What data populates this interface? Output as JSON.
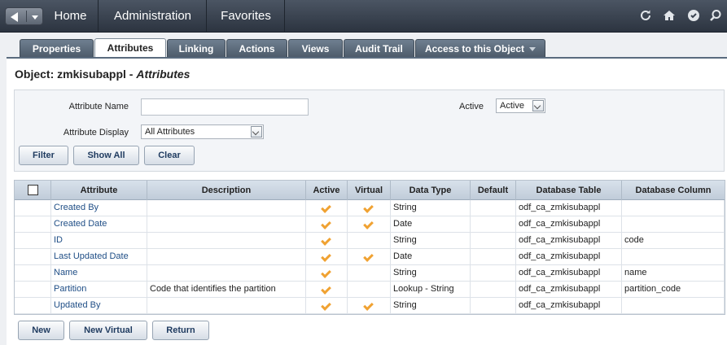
{
  "nav": {
    "home": "Home",
    "administration": "Administration",
    "favorites": "Favorites",
    "icons": [
      "refresh-icon",
      "home-icon",
      "help-icon",
      "search-icon"
    ]
  },
  "tabs": [
    {
      "label": "Properties",
      "active": false
    },
    {
      "label": "Attributes",
      "active": true
    },
    {
      "label": "Linking",
      "active": false
    },
    {
      "label": "Actions",
      "active": false
    },
    {
      "label": "Views",
      "active": false
    },
    {
      "label": "Audit Trail",
      "active": false
    },
    {
      "label": "Access to this Object",
      "active": false
    }
  ],
  "page": {
    "title_prefix": "Object: zmkisubappl - ",
    "title_italic": "Attributes"
  },
  "filter": {
    "attribute_name_label": "Attribute Name",
    "attribute_name_value": "",
    "attribute_display_label": "Attribute Display",
    "attribute_display_value": "All Attributes",
    "active_label": "Active",
    "active_value": "Active",
    "filter_btn": "Filter",
    "show_all_btn": "Show All",
    "clear_btn": "Clear"
  },
  "grid": {
    "columns": [
      "Attribute",
      "Description",
      "Active",
      "Virtual",
      "Data Type",
      "Default",
      "Database Table",
      "Database Column"
    ],
    "rows": [
      {
        "attribute": "Created By",
        "description": "",
        "active": true,
        "virtual": true,
        "data_type": "String",
        "default": "",
        "db_table": "odf_ca_zmkisubappl",
        "db_column": ""
      },
      {
        "attribute": "Created Date",
        "description": "",
        "active": true,
        "virtual": true,
        "data_type": "Date",
        "default": "",
        "db_table": "odf_ca_zmkisubappl",
        "db_column": ""
      },
      {
        "attribute": "ID",
        "description": "",
        "active": true,
        "virtual": false,
        "data_type": "String",
        "default": "",
        "db_table": "odf_ca_zmkisubappl",
        "db_column": "code"
      },
      {
        "attribute": "Last Updated Date",
        "description": "",
        "active": true,
        "virtual": true,
        "data_type": "Date",
        "default": "",
        "db_table": "odf_ca_zmkisubappl",
        "db_column": ""
      },
      {
        "attribute": "Name",
        "description": "",
        "active": true,
        "virtual": false,
        "data_type": "String",
        "default": "",
        "db_table": "odf_ca_zmkisubappl",
        "db_column": "name"
      },
      {
        "attribute": "Partition",
        "description": "Code that identifies the partition",
        "active": true,
        "virtual": false,
        "data_type": "Lookup - String",
        "default": "",
        "db_table": "odf_ca_zmkisubappl",
        "db_column": "partition_code"
      },
      {
        "attribute": "Updated By",
        "description": "",
        "active": true,
        "virtual": true,
        "data_type": "String",
        "default": "",
        "db_table": "odf_ca_zmkisubappl",
        "db_column": ""
      }
    ]
  },
  "actions": {
    "new": "New",
    "new_virtual": "New Virtual",
    "return": "Return"
  }
}
